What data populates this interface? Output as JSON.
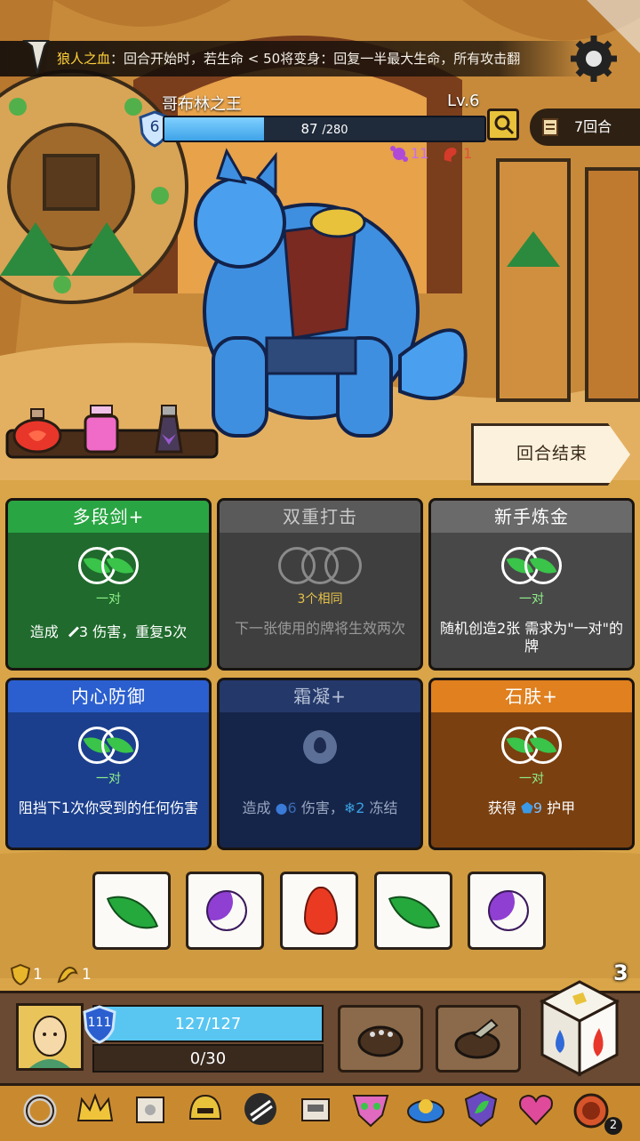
{
  "banner": {
    "name": "狼人之血",
    "text": "：回合开始时，若生命 < 50将变身：回复一半最大生命，所有攻击翻"
  },
  "enemy": {
    "name": "哥布林之王",
    "level": "Lv.6",
    "shield": "6",
    "hp_current": "87",
    "hp_max": "/280",
    "hp_fraction": 0.31,
    "poison": "11",
    "bleed": "1"
  },
  "round_counter": "7回合",
  "end_turn_label": "回合结束",
  "potions": [
    "red-potion",
    "pink-potion",
    "dark-potion"
  ],
  "cards": [
    {
      "title": "多段剑+",
      "requirement": "一对",
      "desc_prefix": "造成 ",
      "desc_value": "3",
      "desc_suffix": " 伤害，重复5次",
      "style": "green"
    },
    {
      "title": "双重打击",
      "requirement": "3个相同",
      "desc": "下一张使用的牌将生效两次",
      "style": "gray-disabled"
    },
    {
      "title": "新手炼金",
      "requirement": "一对",
      "desc": "随机创造2张 需求为\"一对\"的牌",
      "style": "gray"
    },
    {
      "title": "内心防御",
      "requirement": "一对",
      "desc": "阻挡下1次你受到的任何伤害",
      "style": "blue"
    },
    {
      "title": "霜凝+",
      "requirement": "",
      "desc_prefix": "造成 ",
      "desc_value": "6",
      "desc_mid": " 伤害，",
      "desc_value2": "2",
      "desc_suffix": " 冻结",
      "style": "navy-disabled"
    },
    {
      "title": "石肤+",
      "requirement": "一对",
      "desc_prefix": "获得 ",
      "desc_value": "9",
      "desc_suffix": " 护甲",
      "style": "orange"
    }
  ],
  "dice": [
    "leaf",
    "moon",
    "fire",
    "leaf",
    "moon"
  ],
  "status": {
    "armor": "1",
    "strength": "1"
  },
  "dice_count": "3",
  "player": {
    "shield": "111",
    "hp": "127/127",
    "xp": "0/30"
  },
  "relics": [
    "ring-icon",
    "crown-icon",
    "scroll-icon",
    "helmet-icon",
    "claw-icon",
    "scroll2-icon",
    "mask-icon",
    "orb-icon",
    "leaf-shield-icon",
    "heart-icon",
    "bomb-icon"
  ],
  "relic_badge": "2"
}
